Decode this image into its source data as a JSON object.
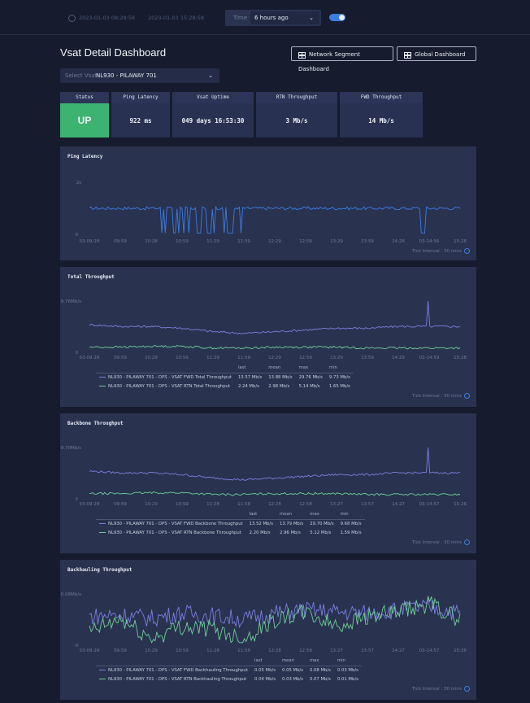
{
  "topbar": {
    "range_start": "2023-01-03 08:28:58",
    "range_end": "2023-01-03 15:28:58",
    "time_label": "Time",
    "time_value": "6 hours ago"
  },
  "header": {
    "title": "Vsat Detail Dashboard",
    "network_segment_button": "Network Segment Dashboard",
    "global_button": "Global Dashboard"
  },
  "vsat_select": {
    "label": "Select Vsat",
    "value": "NL930 - PILAWAY 701"
  },
  "stats": [
    {
      "title": "Status",
      "value": "UP"
    },
    {
      "title": "Ping Latency",
      "value": "922 ms"
    },
    {
      "title": "Vsat Uptime",
      "value": "049 days 16:53:30"
    },
    {
      "title": "RTN Throughput",
      "value": "3 Mb/s"
    },
    {
      "title": "FWD Throughput",
      "value": "14 Mb/s"
    }
  ],
  "colors": {
    "fwd": "#7b7fe0",
    "rtn": "#6fcf97",
    "ping": "#3b7de6",
    "status_up": "#3cb371"
  },
  "tick_interval": "Tick Interval : 30 mins",
  "legend_headers": [
    "last",
    "mean",
    "max",
    "min"
  ],
  "panels": [
    {
      "title": "Ping Latency",
      "ymax_label": "2s",
      "ymin_label": "0",
      "x_ticks": [
        "03-09:29",
        "09:59",
        "10:28",
        "10:59",
        "11:29",
        "11:59",
        "12:29",
        "12:58",
        "13:29",
        "13:59",
        "14:28",
        "03-14:56",
        "15:28"
      ]
    },
    {
      "title": "Total Throughput",
      "ymax_label": "29.76Mb/s",
      "ymin_label": "0",
      "x_ticks": [
        "03-09:29",
        "09:59",
        "10:29",
        "10:59",
        "11:29",
        "11:59",
        "12:29",
        "12:59",
        "13:29",
        "13:59",
        "14:29",
        "03-14:59",
        "15:28"
      ],
      "legend": [
        {
          "name": "NL930 - PILAWAY 701 - DPS - VSAT FWD Total Throughput",
          "last": "13.57 Mb/s",
          "mean": "13.88 Mb/s",
          "max": "29.76 Mb/s",
          "min": "9.73 Mb/s"
        },
        {
          "name": "NL930 - PILAWAY 701 - DPS - VSAT RTN Total Throughput",
          "last": "2.24 Mb/s",
          "mean": "2.98 Mb/s",
          "max": "5.14 Mb/s",
          "min": "1.65 Mb/s"
        }
      ]
    },
    {
      "title": "Backbone Throughput",
      "ymax_label": "29.70Mb/s",
      "ymin_label": "0",
      "x_ticks": [
        "03-09:29",
        "09:59",
        "10:29",
        "10:59",
        "11:28",
        "11:58",
        "12:28",
        "12:58",
        "13:27",
        "13:57",
        "14:27",
        "03-14:57",
        "15:26"
      ],
      "legend": [
        {
          "name": "NL930 - PILAWAY 701 - DPS - VSAT FWD Backbone Throughput",
          "last": "13.52 Mb/s",
          "mean": "13.79 Mb/s",
          "max": "29.70 Mb/s",
          "min": "9.68 Mb/s"
        },
        {
          "name": "NL930 - PILAWAY 701 - DPS - VSAT RTN Backbone Throughput",
          "last": "2.20 Mb/s",
          "mean": "2.96 Mb/s",
          "max": "5.12 Mb/s",
          "min": "1.59 Mb/s"
        }
      ]
    },
    {
      "title": "Backhauling Throughput",
      "ymax_label": "0.08Mb/s",
      "ymin_label": "0",
      "x_ticks": [
        "03-09:29",
        "09:59",
        "10:29",
        "10:59",
        "11:28",
        "11:58",
        "12:28",
        "12:58",
        "13:27",
        "13:57",
        "14:27",
        "03-14:57",
        "15:26"
      ],
      "legend": [
        {
          "name": "NL930 - PILAWAY 701 - DPS - VSAT FWD Backhauling Throughput",
          "last": "0.05 Mb/s",
          "mean": "0.05 Mb/s",
          "max": "0.08 Mb/s",
          "min": "0.03 Mb/s"
        },
        {
          "name": "NL930 - PILAWAY 701 - DPS - VSAT RTN Backhauling Throughput",
          "last": "0.04 Mb/s",
          "mean": "0.03 Mb/s",
          "max": "0.07 Mb/s",
          "min": "0.01 Mb/s"
        }
      ]
    }
  ],
  "chart_data": [
    {
      "type": "line",
      "title": "Ping Latency",
      "ylim": [
        0,
        2
      ],
      "x": [
        "03-09:29",
        "09:59",
        "10:28",
        "10:59",
        "11:29",
        "11:59",
        "12:29",
        "12:58",
        "13:29",
        "13:59",
        "14:28",
        "03-14:56",
        "15:28"
      ],
      "series": [
        {
          "values": [
            1.0,
            1.0,
            0.1,
            1.05,
            0.1,
            1.0,
            1.0,
            1.0,
            1.0,
            1.02,
            1.0,
            0.1,
            1.0
          ]
        }
      ]
    },
    {
      "type": "line",
      "title": "Total Throughput",
      "ylim": [
        0,
        29.76
      ],
      "x": [
        "03-09:29",
        "09:59",
        "10:29",
        "10:59",
        "11:29",
        "11:59",
        "12:29",
        "12:59",
        "13:29",
        "13:59",
        "14:29",
        "03-14:59",
        "15:28"
      ],
      "series": [
        {
          "name": "NL930 - PILAWAY 701 - DPS - VSAT FWD Total Throughput",
          "values": [
            16,
            15,
            15,
            14,
            12,
            11,
            12,
            13,
            14,
            14,
            15,
            29.76,
            13.57
          ]
        },
        {
          "name": "NL930 - PILAWAY 701 - DPS - VSAT RTN Total Throughput",
          "values": [
            3,
            3,
            3.5,
            3.5,
            2.5,
            2.5,
            3,
            3,
            3,
            2.5,
            2.5,
            3,
            2.24
          ]
        }
      ]
    },
    {
      "type": "line",
      "title": "Backbone Throughput",
      "ylim": [
        0,
        29.7
      ],
      "x": [
        "03-09:29",
        "09:59",
        "10:29",
        "10:59",
        "11:28",
        "11:58",
        "12:28",
        "12:58",
        "13:27",
        "13:57",
        "14:27",
        "03-14:57",
        "15:26"
      ],
      "series": [
        {
          "name": "NL930 - PILAWAY 701 - DPS - VSAT FWD Backbone Throughput",
          "values": [
            16,
            15,
            15,
            14,
            12,
            11,
            12,
            13,
            14,
            14,
            15,
            29.7,
            13.52
          ]
        },
        {
          "name": "NL930 - PILAWAY 701 - DPS - VSAT RTN Backbone Throughput",
          "values": [
            3,
            3,
            3.5,
            3.5,
            2.5,
            2.5,
            3,
            3,
            3,
            2.5,
            2.5,
            3,
            2.2
          ]
        }
      ]
    },
    {
      "type": "line",
      "title": "Backhauling Throughput",
      "ylim": [
        0,
        0.08
      ],
      "x": [
        "03-09:29",
        "09:59",
        "10:29",
        "10:59",
        "11:28",
        "11:58",
        "12:28",
        "12:58",
        "13:27",
        "13:57",
        "14:27",
        "03-14:57",
        "15:26"
      ],
      "series": [
        {
          "name": "NL930 - PILAWAY 701 - DPS - VSAT FWD Backhauling Throughput",
          "values": [
            0.045,
            0.048,
            0.042,
            0.05,
            0.046,
            0.04,
            0.05,
            0.055,
            0.052,
            0.05,
            0.055,
            0.06,
            0.05
          ]
        },
        {
          "name": "NL930 - PILAWAY 701 - DPS - VSAT RTN Backhauling Throughput",
          "values": [
            0.02,
            0.04,
            0.01,
            0.03,
            0.025,
            0.01,
            0.04,
            0.05,
            0.03,
            0.045,
            0.05,
            0.065,
            0.04
          ]
        }
      ]
    }
  ]
}
